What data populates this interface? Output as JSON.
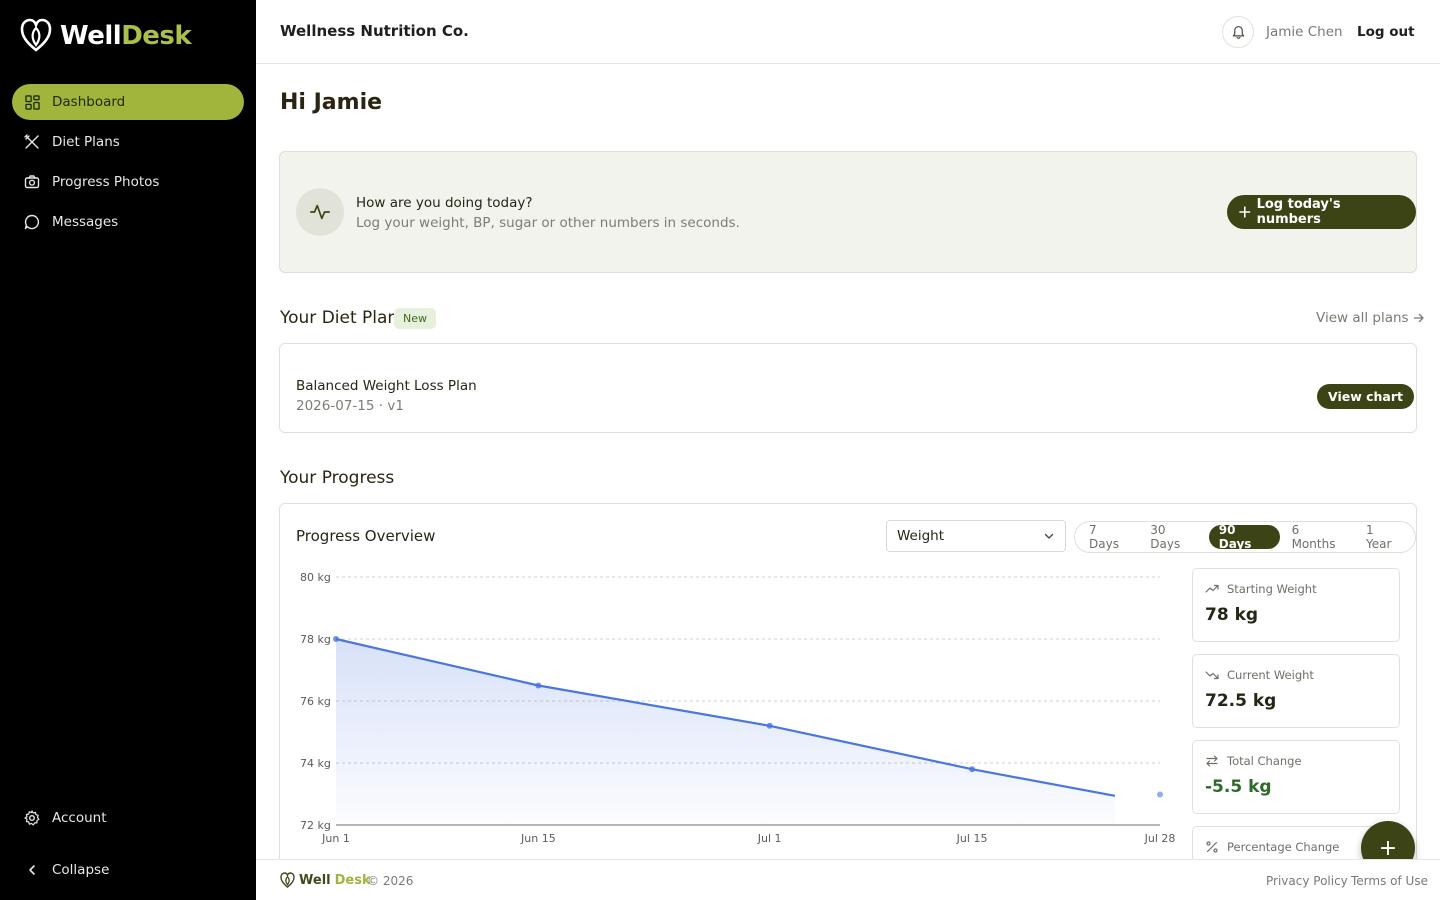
{
  "brand": {
    "name_part1": "Well",
    "name_part2": "Desk",
    "accent": "#a1b43c",
    "dark_accent": "#3c4416"
  },
  "sidebar": {
    "items": [
      {
        "label": "Dashboard",
        "icon": "dashboard-grid-icon",
        "active": true
      },
      {
        "label": "Diet Plans",
        "icon": "utensils-icon",
        "active": false
      },
      {
        "label": "Progress Photos",
        "icon": "camera-icon",
        "active": false
      },
      {
        "label": "Messages",
        "icon": "message-bubble-icon",
        "active": false
      }
    ],
    "account_label": "Account",
    "collapse_label": "Collapse"
  },
  "header": {
    "org_name": "Wellness Nutrition Co.",
    "user_name": "Jamie Chen",
    "logout_label": "Log out"
  },
  "greeting": "Hi Jamie",
  "checkin": {
    "title": "How are you doing today?",
    "subtitle": "Log your weight, BP, sugar or other numbers in seconds.",
    "button_label": "Log today's numbers"
  },
  "diet_plan": {
    "section_title": "Your Diet Plan",
    "badge": "New",
    "view_all_label": "View all plans",
    "plan_name": "Balanced Weight Loss Plan",
    "plan_meta": "2026-07-15 · v1",
    "view_chart_label": "View chart"
  },
  "progress": {
    "section_title": "Your Progress",
    "card_title": "Progress Overview",
    "metric_selected": "Weight",
    "ranges": [
      {
        "label": "7 Days",
        "active": false
      },
      {
        "label": "30 Days",
        "active": false
      },
      {
        "label": "90 Days",
        "active": true
      },
      {
        "label": "6 Months",
        "active": false
      },
      {
        "label": "1 Year",
        "active": false
      }
    ],
    "stats": [
      {
        "label": "Starting Weight",
        "value": "78 kg",
        "icon": "trend-up-icon"
      },
      {
        "label": "Current Weight",
        "value": "72.5 kg",
        "icon": "trend-down-icon"
      },
      {
        "label": "Total Change",
        "value": "-5.5 kg",
        "icon": "arrows-swap-icon"
      },
      {
        "label": "Percentage Change",
        "value": "",
        "icon": "percent-icon"
      }
    ]
  },
  "chart_data": {
    "type": "area",
    "x": [
      "2026-06-01",
      "2026-06-15",
      "2026-07-01",
      "2026-07-15",
      "2026-07-28"
    ],
    "x_ticks": [
      "Jun 1",
      "Jun 15",
      "Jul 1",
      "Jul 15",
      "Jul 28"
    ],
    "series": [
      {
        "values": [
          78,
          76.5,
          75.2,
          73.8,
          72.5
        ],
        "color": "#4a76e0"
      }
    ],
    "y_ticks": [
      "80 kg",
      "78 kg",
      "76 kg",
      "74 kg",
      "72 kg"
    ],
    "ylim": [
      72,
      80
    ],
    "grid": true
  },
  "footer": {
    "brand_part1": "Well",
    "brand_part2": "Desk",
    "copyright": "© 2026",
    "privacy_label": "Privacy Policy",
    "terms_label": "Terms of Use"
  },
  "fab_label": "+"
}
